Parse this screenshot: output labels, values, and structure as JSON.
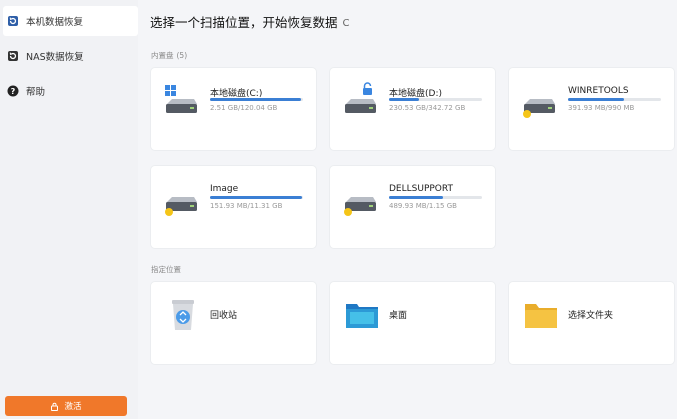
{
  "sidebar": {
    "items": [
      {
        "label": "本机数据恢复",
        "icon": "restore-icon",
        "active": true
      },
      {
        "label": "NAS数据恢复",
        "icon": "nas-restore-icon",
        "active": false
      },
      {
        "label": "帮助",
        "icon": "help-icon",
        "active": false
      }
    ],
    "activate_label": "激活"
  },
  "main": {
    "title": "选择一个扫描位置，开始恢复数据",
    "drives_section": {
      "label": "内置盘",
      "count": "(5)"
    },
    "drives": [
      {
        "name": "本地磁盘(C:)",
        "size": "2.51 GB/120.04 GB",
        "usage": 0.979,
        "icon": "windows-drive-icon"
      },
      {
        "name": "本地磁盘(D:)",
        "size": "230.53 GB/342.72 GB",
        "usage": 0.327,
        "icon": "locked-drive-icon"
      },
      {
        "name": "WINRETOOLS",
        "size": "391.93 MB/990 MB",
        "usage": 0.604,
        "icon": "drive-icon"
      },
      {
        "name": "Image",
        "size": "151.93 MB/11.31 GB",
        "usage": 0.987,
        "icon": "drive-icon"
      },
      {
        "name": "DELLSUPPORT",
        "size": "489.93 MB/1.15 GB",
        "usage": 0.584,
        "icon": "drive-icon"
      }
    ],
    "locations_section": {
      "label": "指定位置"
    },
    "locations": [
      {
        "label": "回收站",
        "icon": "recycle-bin-icon"
      },
      {
        "label": "桌面",
        "icon": "desktop-icon"
      },
      {
        "label": "选择文件夹",
        "icon": "folder-icon"
      }
    ]
  },
  "colors": {
    "accent": "#3b7fd4",
    "activate": "#f0782a",
    "folder": "#f5c342",
    "warning_badge": "#f5c518"
  }
}
